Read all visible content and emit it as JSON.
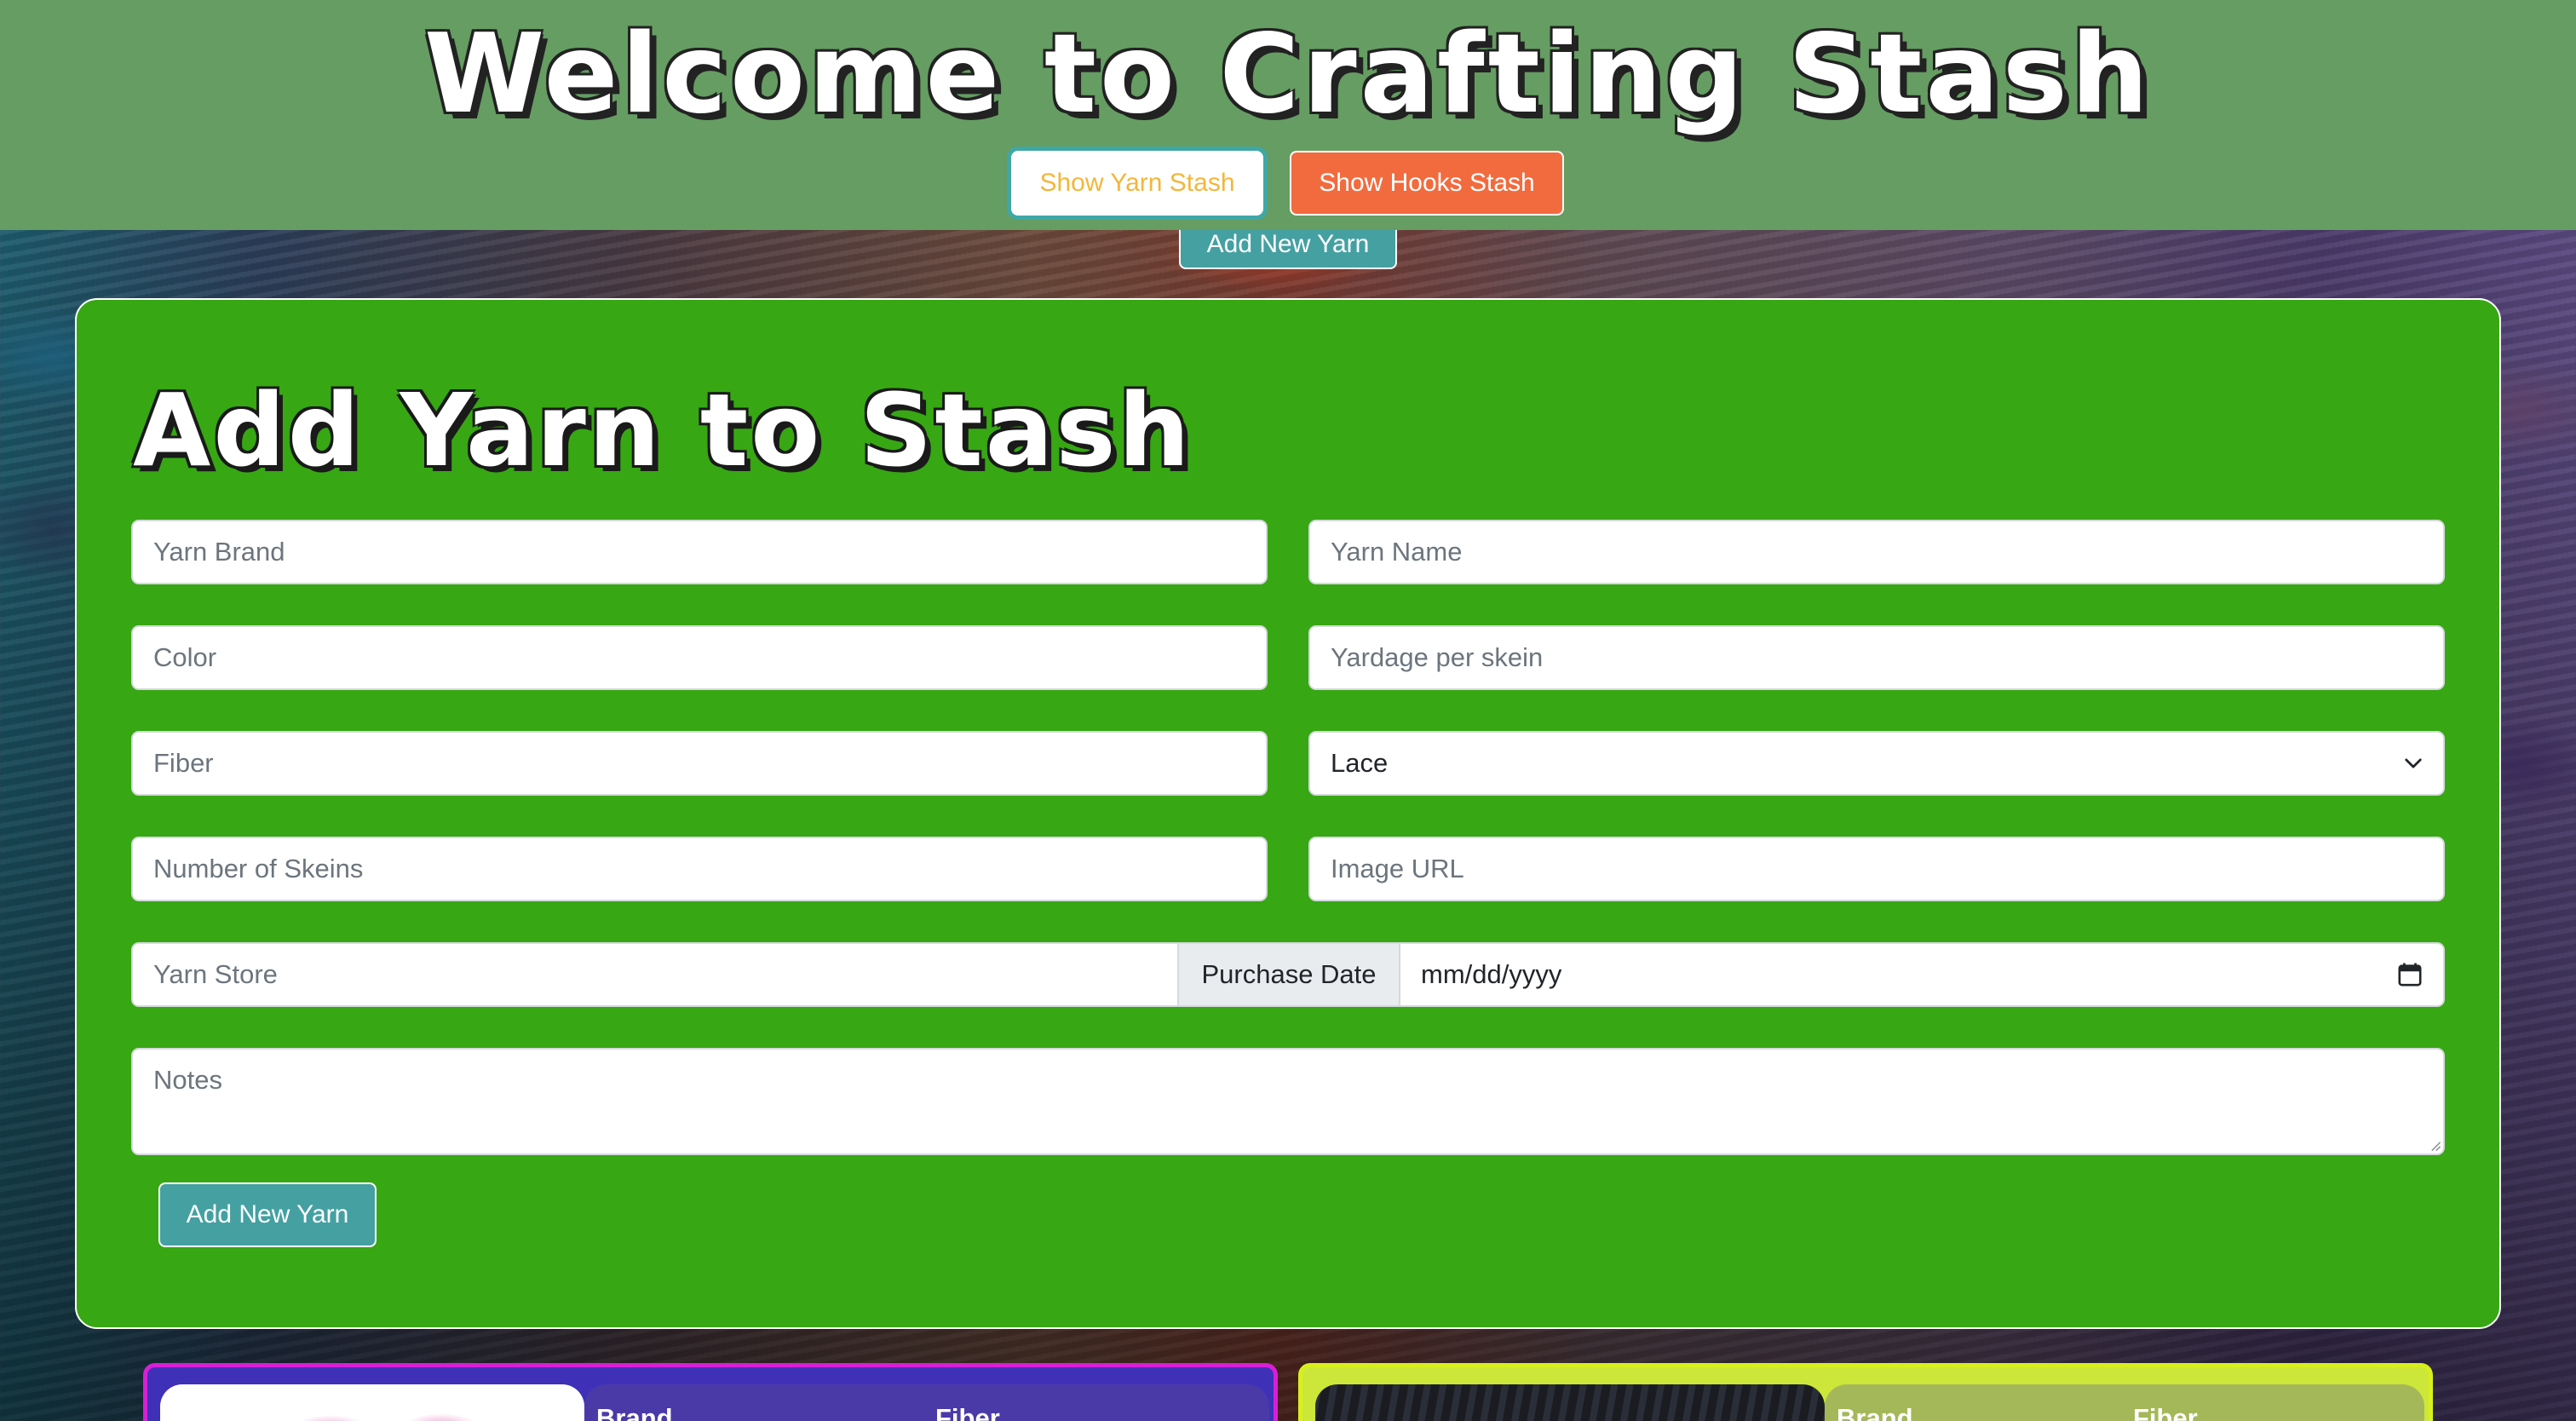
{
  "header": {
    "title": "Welcome to Crafting Stash",
    "buttons": {
      "show_yarn": "Show Yarn Stash",
      "show_hooks": "Show Hooks Stash"
    },
    "add_new_yarn_top": "Add New Yarn"
  },
  "form": {
    "title": "Add Yarn to Stash",
    "fields": {
      "yarn_brand": {
        "placeholder": "Yarn Brand",
        "value": ""
      },
      "yarn_name": {
        "placeholder": "Yarn Name",
        "value": ""
      },
      "color": {
        "placeholder": "Color",
        "value": ""
      },
      "yardage": {
        "placeholder": "Yardage per skein",
        "value": ""
      },
      "fiber": {
        "placeholder": "Fiber",
        "value": ""
      },
      "weight": {
        "selected": "Lace"
      },
      "skeins": {
        "placeholder": "Number of Skeins",
        "value": ""
      },
      "image_url": {
        "placeholder": "Image URL",
        "value": ""
      },
      "yarn_store": {
        "placeholder": "Yarn Store",
        "value": ""
      },
      "purchase_date_label": "Purchase Date",
      "purchase_date_value": "mm/dd/yyyy",
      "notes": {
        "placeholder": "Notes",
        "value": ""
      }
    },
    "submit_label": "Add New Yarn"
  },
  "stash_cards": [
    {
      "headers": [
        "Brand",
        "Fiber"
      ],
      "accent": "#d81fd6",
      "bg": "#3f30b8"
    },
    {
      "headers": [
        "Brand",
        "Fiber"
      ],
      "accent": "#d7f01c",
      "bg": "#cde63a"
    }
  ],
  "colors": {
    "header_bg": "#659d62",
    "form_bg": "#37a713",
    "teal_button": "#45a0a2",
    "orange_button": "#f26b3e",
    "yellow_text": "#f4b63a"
  },
  "icons": {
    "select_chevron": "chevron-down-icon",
    "date_picker": "calendar-icon",
    "textarea_resize": "resize-grip-icon"
  }
}
